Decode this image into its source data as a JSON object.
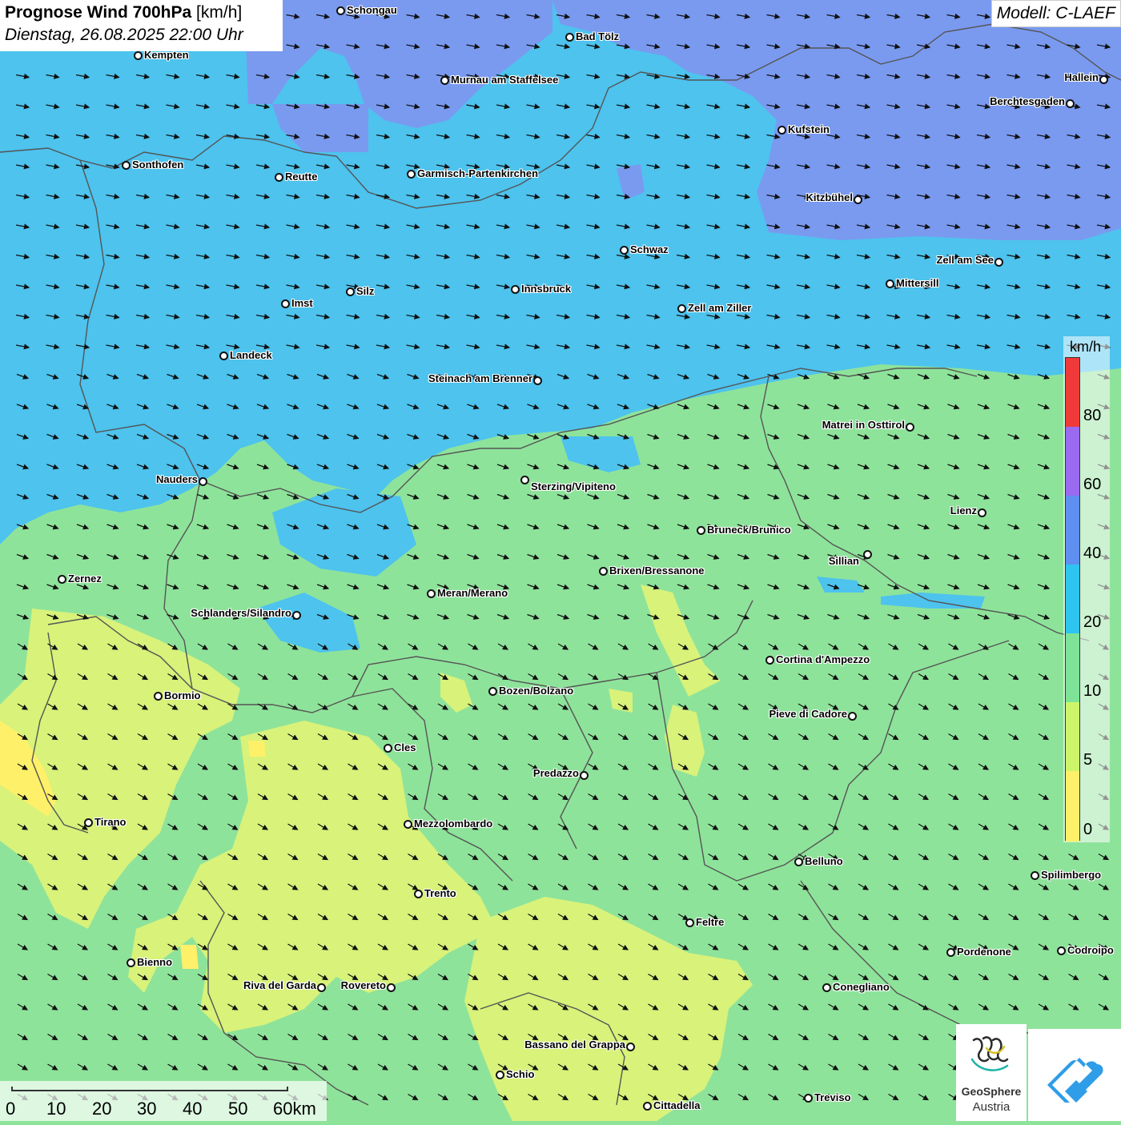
{
  "title": {
    "main_bold": "Prognose Wind 700hPa",
    "main_unit": "[km/h]",
    "subtitle": "Dienstag, 26.08.2025 22:00 Uhr"
  },
  "model": "Modell: C-LAEF",
  "legend": {
    "unit": "km/h",
    "ticks": [
      "80",
      "60",
      "40",
      "20",
      "10",
      "5",
      "0"
    ],
    "colors": [
      "#fff06a",
      "#cdf56a",
      "#7ee396",
      "#2ec4f0",
      "#5f8ff0",
      "#9a6af0",
      "#f03a3a",
      "#8fd9f5"
    ]
  },
  "colors": {
    "calm": "#fff06a",
    "light": "#d8f27a",
    "moderate": "#8ee39a",
    "fresh": "#4dc3ee",
    "strong": "#7a9af0",
    "border": "#555555"
  },
  "wind_direction": "west-northwest, pointing east-southeast",
  "cities": [
    {
      "name": "Schongau"
    },
    {
      "name": "Bad Tölz"
    },
    {
      "name": "Kempten"
    },
    {
      "name": "Murnau am Staffelsee"
    },
    {
      "name": "Hallein"
    },
    {
      "name": "Berchtesgaden"
    },
    {
      "name": "Kufstein"
    },
    {
      "name": "Sonthofen"
    },
    {
      "name": "Reutte"
    },
    {
      "name": "Garmisch-Partenkirchen"
    },
    {
      "name": "Kitzbühel"
    },
    {
      "name": "Schwaz"
    },
    {
      "name": "Zell am See"
    },
    {
      "name": "Mittersill"
    },
    {
      "name": "Innsbruck"
    },
    {
      "name": "Silz"
    },
    {
      "name": "Imst"
    },
    {
      "name": "Zell am Ziller"
    },
    {
      "name": "Landeck"
    },
    {
      "name": "Steinach am Brenner"
    },
    {
      "name": "Matrei in Osttirol"
    },
    {
      "name": "Nauders"
    },
    {
      "name": "Sterzing/Vipiteno"
    },
    {
      "name": "Lienz"
    },
    {
      "name": "Bruneck/Brunico"
    },
    {
      "name": "Sillian"
    },
    {
      "name": "Brixen/Bressanone"
    },
    {
      "name": "Zernez"
    },
    {
      "name": "Meran/Merano"
    },
    {
      "name": "Schlanders/Silandro"
    },
    {
      "name": "Cortina d'Ampezzo"
    },
    {
      "name": "Bormio"
    },
    {
      "name": "Bozen/Bolzano"
    },
    {
      "name": "Pieve di Cadore"
    },
    {
      "name": "Cles"
    },
    {
      "name": "Predazzo"
    },
    {
      "name": "Tirano"
    },
    {
      "name": "Mezzolombardo"
    },
    {
      "name": "Belluno"
    },
    {
      "name": "Spilimbergo"
    },
    {
      "name": "Trento"
    },
    {
      "name": "Feltre"
    },
    {
      "name": "Pordenone"
    },
    {
      "name": "Codroipo"
    },
    {
      "name": "Bienno"
    },
    {
      "name": "Riva del Garda"
    },
    {
      "name": "Rovereto"
    },
    {
      "name": "Conegliano"
    },
    {
      "name": "Bassano del Grappa"
    },
    {
      "name": "Schio"
    },
    {
      "name": "Treviso"
    },
    {
      "name": "Cittadella"
    }
  ],
  "scale": {
    "labels": [
      "0",
      "10",
      "20",
      "30",
      "40",
      "50",
      "60km"
    ]
  },
  "logo": {
    "line1": "GeoSphere",
    "line2": "Austria"
  }
}
